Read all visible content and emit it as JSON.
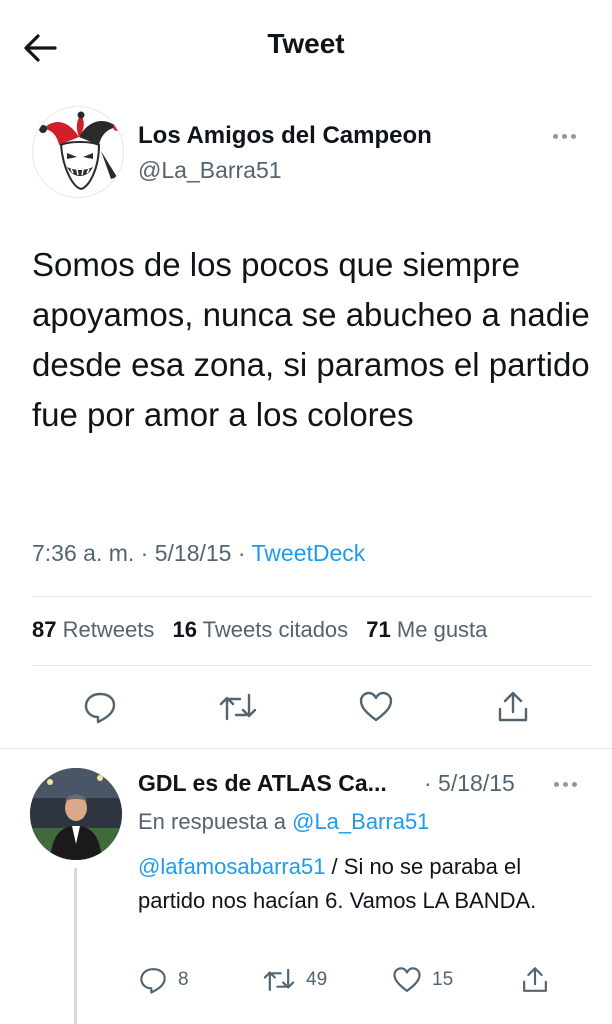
{
  "header": {
    "title": "Tweet",
    "back_icon": "arrow-left-icon"
  },
  "tweet": {
    "author_name": "Los Amigos del Campeon",
    "author_handle": "@La_Barra51",
    "text": "Somos de los pocos que siempre apoyamos, nunca se abucheo a nadie desde esa zona, si paramos el partido fue por amor a los colores",
    "time": "7:36 a. m.",
    "date": "5/18/15",
    "source": "TweetDeck",
    "stats": {
      "retweets_count": "87",
      "retweets_label": "Retweets",
      "quotes_count": "16",
      "quotes_label": "Tweets citados",
      "likes_count": "71",
      "likes_label": "Me gusta"
    },
    "actions": [
      "reply-icon",
      "retweet-icon",
      "like-icon",
      "share-icon"
    ]
  },
  "reply": {
    "author_name": "GDL es de ATLAS Ca...",
    "date": "· 5/18/15",
    "in_reply_to_prefix": "En respuesta a",
    "in_reply_to_handle": "@La_Barra51",
    "mention": "@lafamosabarra51",
    "text": " / Si no se paraba el partido nos hacían 6. Vamos LA BANDA.",
    "reply_count": "8",
    "retweet_count": "49",
    "like_count": "15"
  },
  "colors": {
    "link": "#1d9bf0",
    "secondary_text": "#536471",
    "primary_text": "#0f1419",
    "divider": "#e6e9ec"
  }
}
